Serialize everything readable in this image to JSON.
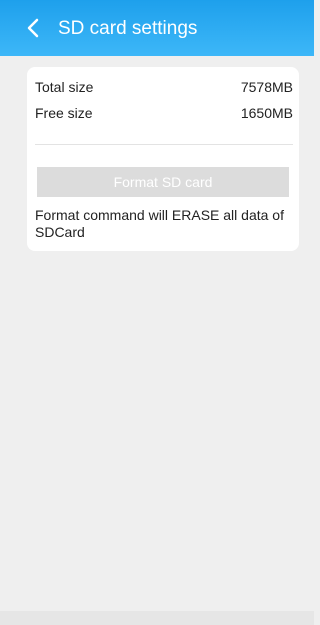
{
  "header": {
    "title": "SD card settings",
    "back_icon": "chevron-left-icon",
    "bg_colors": [
      "#1ea0ec",
      "#3db7f8"
    ]
  },
  "sd_info": {
    "total_label": "Total size",
    "total_value": "7578MB",
    "free_label": "Free size",
    "free_value": "1650MB"
  },
  "actions": {
    "format_label": "Format SD card"
  },
  "notice": {
    "text": "Format command will ERASE all data of SDCard"
  }
}
